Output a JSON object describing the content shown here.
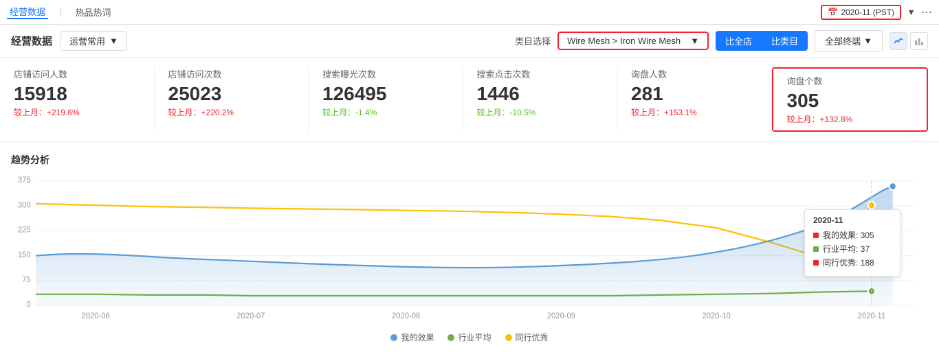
{
  "topNav": {
    "items": [
      {
        "label": "经营数据",
        "active": true
      },
      {
        "label": "热品热词",
        "active": false
      }
    ],
    "dateSelector": {
      "icon": "calendar-icon",
      "value": "2020-11 (PST)"
    },
    "chevronIcon": "chevron-down-icon"
  },
  "header": {
    "title": "经营数据",
    "dropdown": {
      "label": "运营常用",
      "chevron": "chevron-down-icon"
    },
    "categoryLabel": "类目选择",
    "categoryValue": "Wire Mesh > Iron Wire Mesh",
    "categoryChevron": "chevron-down-icon",
    "buttons": {
      "compareStore": "比全店",
      "compareCategory": "比类目",
      "terminal": "全部终端",
      "terminalChevron": "chevron-down-icon"
    }
  },
  "metrics": [
    {
      "label": "店铺访问人数",
      "value": "15918",
      "change": "+219.6%",
      "changeType": "positive",
      "changePrefix": "较上月："
    },
    {
      "label": "店铺访问次数",
      "value": "25023",
      "change": "+220.2%",
      "changeType": "positive",
      "changePrefix": "较上月："
    },
    {
      "label": "搜索曝光次数",
      "value": "126495",
      "change": "-1.4%",
      "changeType": "negative",
      "changePrefix": "较上月："
    },
    {
      "label": "搜索点击次数",
      "value": "1446",
      "change": "-10.5%",
      "changeType": "negative",
      "changePrefix": "较上月："
    },
    {
      "label": "询盘人数",
      "value": "281",
      "change": "+153.1%",
      "changeType": "positive",
      "changePrefix": "较上月："
    },
    {
      "label": "询盘个数",
      "value": "305",
      "change": "+132.8%",
      "changeType": "positive",
      "changePrefix": "较上月："
    }
  ],
  "chart": {
    "title": "趋势分析",
    "yLabels": [
      "375",
      "300",
      "225",
      "150",
      "75",
      "0"
    ],
    "xLabels": [
      "2020-06",
      "2020-07",
      "2020-08",
      "2020-09",
      "2020-10",
      "2020-11"
    ],
    "legend": [
      {
        "label": "我的效果",
        "color": "#5B9BD5",
        "type": "dot"
      },
      {
        "label": "行业平均",
        "color": "#70AD47",
        "type": "dot"
      },
      {
        "label": "同行优秀",
        "color": "#FFC000",
        "type": "dot"
      }
    ],
    "tooltip": {
      "date": "2020-11",
      "rows": [
        {
          "label": "我的效果: 305",
          "color": "#f5222d"
        },
        {
          "label": "行业平均: 37",
          "color": "#70AD47"
        },
        {
          "label": "同行优秀: 188",
          "color": "#f5222d"
        }
      ]
    }
  }
}
